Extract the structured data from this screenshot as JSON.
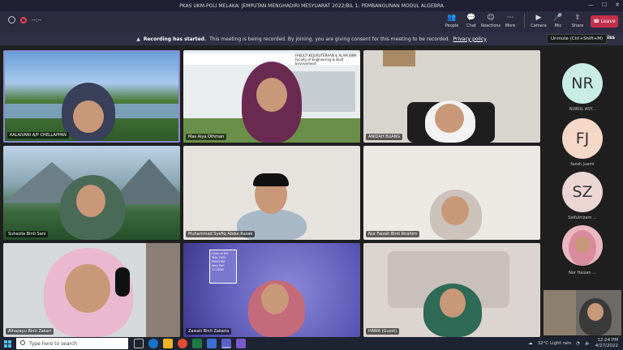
{
  "window": {
    "title": "PKAS UKM-POLI MELAKA: JEMPUTAN MENGHADIRI MESYUARAT 2022/BIL 1: PEMBANGUNAN MODUL ALGEBRA",
    "min": "—",
    "max": "☐",
    "close": "✕"
  },
  "toolbar": {
    "timer": "--:--",
    "buttons": [
      {
        "label": "People",
        "icon": "people-icon",
        "glyph": "👥"
      },
      {
        "label": "Chat",
        "icon": "chat-icon",
        "glyph": "💬"
      },
      {
        "label": "Reactions",
        "icon": "reactions-icon",
        "glyph": "☺"
      },
      {
        "label": "More",
        "icon": "more-icon",
        "glyph": "⋯"
      }
    ],
    "media": [
      {
        "label": "Camera",
        "icon": "camera-icon",
        "glyph": "▶"
      },
      {
        "label": "Mic",
        "icon": "mic-icon",
        "glyph": "🎤"
      },
      {
        "label": "Share",
        "icon": "share-icon",
        "glyph": "⇧"
      }
    ],
    "leave_label": "Leave"
  },
  "banner": {
    "title": "Recording has started.",
    "text": "This meeting is being recorded. By joining, you are giving consent for this meeting to be recorded.",
    "link": "Privacy policy",
    "dismiss": "Dismiss"
  },
  "tooltip": "Unmute (Ctrl+Shift+M)",
  "tiles": [
    {
      "name": "KALAIVANI A/P CHELLAPPAN"
    },
    {
      "name": "Mas Aiya Othman",
      "poster_line1": "FAKULTI KEJURUTERAAN & ALAM BINA",
      "poster_line2": "Faculty of Engineering & Built Environment"
    },
    {
      "name": "ANIDAH BUANG"
    },
    {
      "name": "Suhaizla Binti Sani"
    },
    {
      "name": "Muhammad Syafiq Abdul Razak"
    },
    {
      "name": "Nur Faizah Binti Ibrahim"
    },
    {
      "name": "Alhazayu Binti Zakari"
    },
    {
      "name": "Zawati Binti Zakaria",
      "poster_line1": "Color of the Year 2022",
      "poster_line2": "PANTONE",
      "poster_line3": "Very Peri",
      "poster_line4": "17-3938"
    },
    {
      "name": "HAWA (Guest)"
    }
  ],
  "sidebar": [
    {
      "initials": "NR",
      "name": "NURUL ASY...",
      "color": "#c9ede4"
    },
    {
      "initials": "FJ",
      "name": "fazah juami",
      "color": "#f6d8c8"
    },
    {
      "initials": "SZ",
      "name": "Saifulnizam ...",
      "color": "#ecd6d4"
    },
    {
      "initials": "",
      "name": "Nor Haizan ...",
      "color": "#e9b8c0"
    }
  ],
  "taskbar": {
    "search_placeholder": "Type here to search",
    "weather": "32°C  Light rain",
    "time": "12:24 PM",
    "date": "4/27/2022"
  }
}
